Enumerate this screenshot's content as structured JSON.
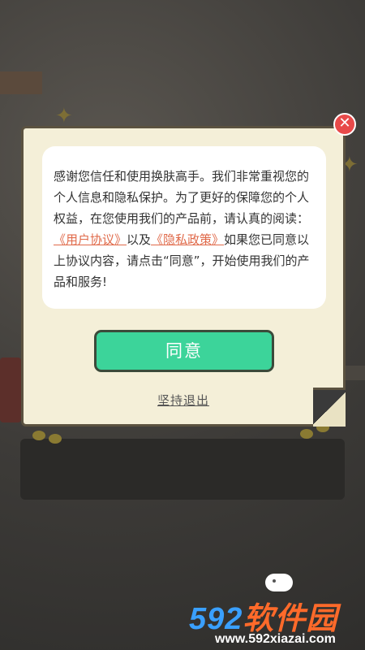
{
  "dialog": {
    "close_icon": "✕",
    "text_part1": "感谢您信任和使用换肤高手。我们非常重视您的个人信息和隐私保护。为了更好的保障您的个人权益，在您使用我们的产品前，请认真的阅读：",
    "link_user": "《用户协议》",
    "text_mid": "以及",
    "link_privacy": "《隐私政策》",
    "text_part2": "如果您已同意以上协议内容，请点击“同意”，开始使用我们的产品和服务!",
    "agree_label": "同意",
    "quit_label": "坚持退出"
  },
  "watermark": {
    "brand_num": "592",
    "brand_text": "软件园",
    "url": "www.592xiazai.com"
  },
  "colors": {
    "agree": "#3cd49a",
    "link": "#e06a4a",
    "close": "#e84a4a"
  }
}
